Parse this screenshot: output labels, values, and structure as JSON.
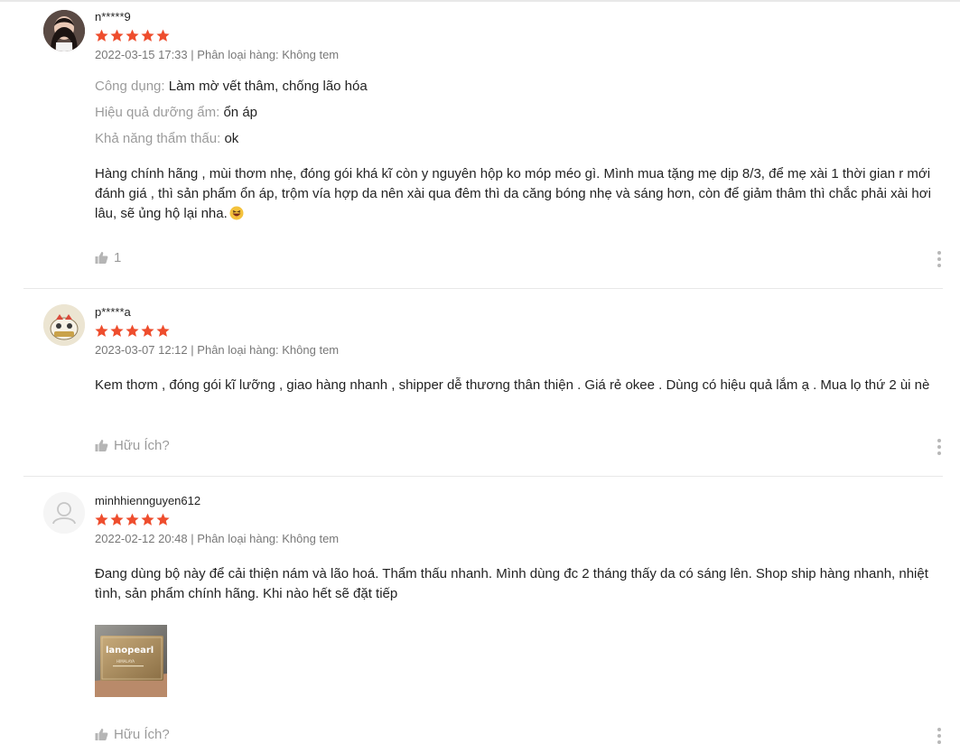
{
  "reviews": [
    {
      "username": "n*****9",
      "rating": 5,
      "date": "2022-03-15 17:33",
      "separator": "|",
      "variation": "Phân loại hàng: Không tem",
      "attributes": [
        {
          "label": "Công dụng:",
          "value": "Làm mờ vết thâm, chống lão hóa"
        },
        {
          "label": "Hiệu quả dưỡng ẩm:",
          "value": "ổn áp"
        },
        {
          "label": "Khả năng thẩm thấu:",
          "value": "ok"
        }
      ],
      "comment": "Hàng chính hãng , mùi thơm nhẹ, đóng gói khá kĩ còn y nguyên hộp ko móp méo gì. Mình mua tặng mẹ dịp 8/3, để mẹ xài 1 thời gian r mới đánh giá , thì sản phẩm ổn áp, trộm vía hợp da nên xài qua đêm thì da căng bóng nhẹ và sáng hơn, còn để giảm thâm thì chắc phải xài hơi lâu, sẽ ủng hộ lại nha.",
      "likes": "1"
    },
    {
      "username": "p*****a",
      "rating": 5,
      "date": "2023-03-07 12:12",
      "separator": "|",
      "variation": "Phân loại hàng: Không tem",
      "comment": "Kem thơm , đóng gói kĩ lưỡng , giao hàng nhanh , shipper dễ thương thân thiện . Giá rẻ okee . Dùng có hiệu quả lắm ạ . Mua lọ thứ 2 ùi nè",
      "likes": "Hữu Ích?"
    },
    {
      "username": "minhhiennguyen612",
      "rating": 5,
      "date": "2022-02-12 20:48",
      "separator": "|",
      "variation": "Phân loại hàng: Không tem",
      "comment": "Đang dùng bộ này để cải thiện nám và lão hoá. Thẩm thấu nhanh. Mình dùng đc 2 tháng thấy da có sáng lên. Shop ship hàng nhanh, nhiệt tình, sản phẩm chính hãng. Khi nào hết sẽ đặt tiếp",
      "photo": {
        "brand": "lanopearl",
        "product": "HIMALAYA"
      },
      "likes": "Hữu Ích?"
    }
  ],
  "colors": {
    "star": "#ee4d2d",
    "divider": "#e8e8e8",
    "muted": "rgba(0,0,0,0.4)"
  },
  "icons": [
    "star-icon",
    "thumbs-up-icon",
    "more-vertical-icon",
    "default-avatar-icon",
    "grinning-emoji-icon"
  ]
}
